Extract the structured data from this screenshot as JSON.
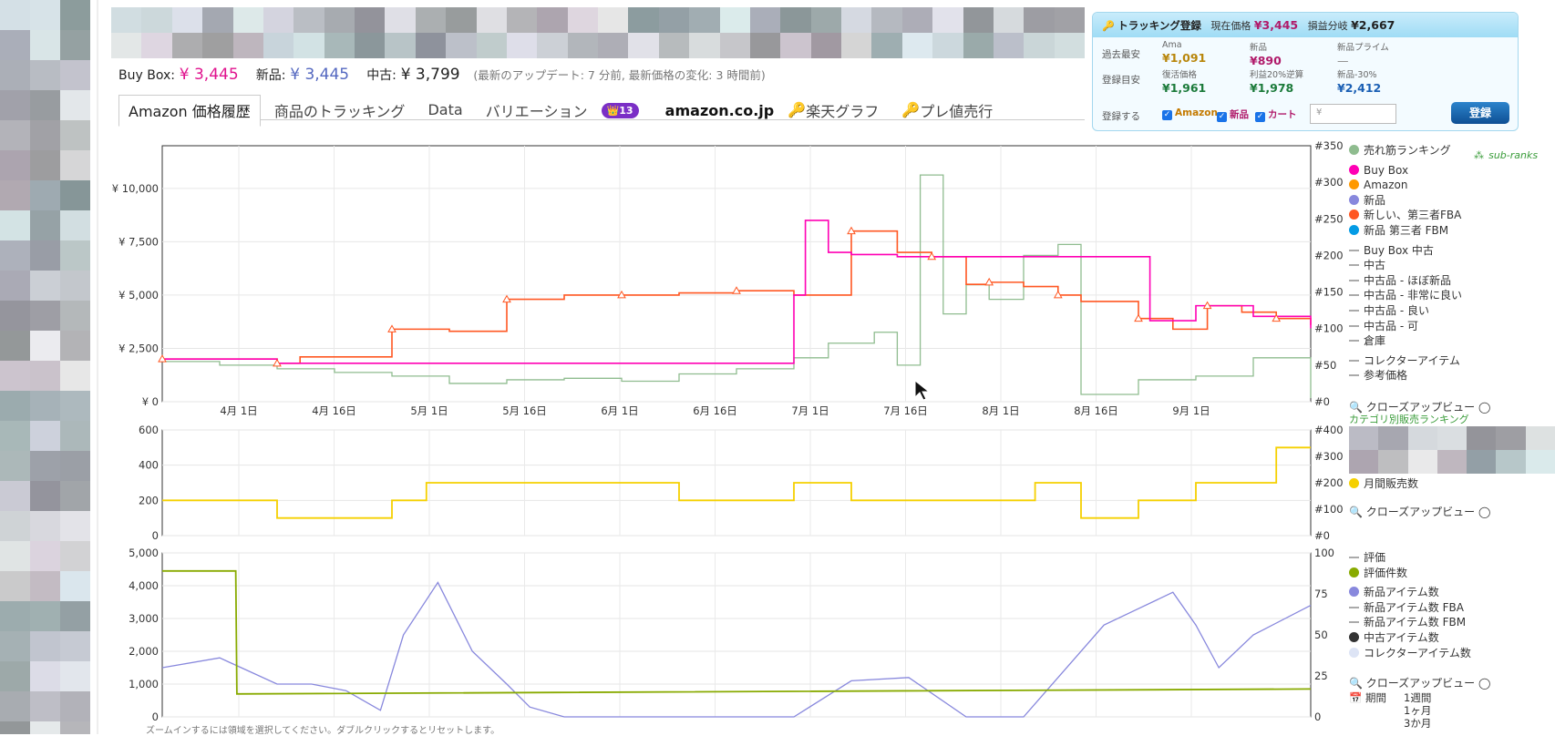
{
  "prices_bar": {
    "buybox_label": "Buy Box:",
    "buybox_value": "¥ 3,445",
    "new_label": "新品:",
    "new_value": "¥ 3,445",
    "used_label": "中古:",
    "used_value": "¥ 3,799",
    "update_note": "(最新のアップデート: 7 分前, 最新価格の変化: 3 時間前)"
  },
  "tabs": {
    "t1": "Amazon 価格履歴",
    "t2": "商品のトラッキング",
    "t3": "Data",
    "t4": "バリエーション",
    "badge": "👑13",
    "amazon_logo": "amazon.co.jp",
    "t5": "楽天グラフ",
    "t6": "プレ値売行"
  },
  "tracking": {
    "title": "トラッキング登録",
    "current_label": "現在価格",
    "current_value": "¥3,445",
    "breakeven_label": "損益分岐",
    "breakeven_value": "¥2,667",
    "row1_label": "過去最安",
    "row2_label": "登録目安",
    "row3_label": "登録する",
    "c_ama_label": "Ama",
    "c_ama_value": "¥1,091",
    "c_new_label": "新品",
    "c_new_value": "¥890",
    "c_prime_label": "新品プライム",
    "c_prime_value": "—",
    "c_revive_label": "復活価格",
    "c_revive_value": "¥1,961",
    "c_profit_label": "利益20%逆算",
    "c_profit_value": "¥1,978",
    "c_new30_label": "新品-30%",
    "c_new30_value": "¥2,412",
    "chk_amazon": "Amazon",
    "chk_new": "新品",
    "chk_cart": "カート",
    "input_placeholder": "¥",
    "register_button": "登録"
  },
  "legend1": {
    "items": [
      {
        "label": "売れ筋ランキング",
        "color": "#8fbc8f"
      },
      {
        "label": "Buy Box",
        "color": "#ff00b4"
      },
      {
        "label": "Amazon",
        "color": "#ff9900"
      },
      {
        "label": "新品",
        "color": "#8888dd"
      },
      {
        "label": "新しい、第三者FBA",
        "color": "#ff5722"
      },
      {
        "label": "新品 第三者 FBM",
        "color": "#039be5"
      },
      {
        "label": "Buy Box 中古",
        "color": "#aaaaaa"
      },
      {
        "label": "中古",
        "color": "#aaaaaa"
      },
      {
        "label": "中古品 - ほぼ新品",
        "color": "#aaaaaa"
      },
      {
        "label": "中古品 - 非常に良い",
        "color": "#aaaaaa"
      },
      {
        "label": "中古品 - 良い",
        "color": "#aaaaaa"
      },
      {
        "label": "中古品 - 可",
        "color": "#aaaaaa"
      },
      {
        "label": "倉庫",
        "color": "#aaaaaa"
      },
      {
        "label": "コレクターアイテム",
        "color": "#aaaaaa"
      },
      {
        "label": "参考価格",
        "color": "#aaaaaa"
      }
    ],
    "subranks": "sub-ranks",
    "zoom_label": "クローズアップビュー",
    "category_rank": "カテゴリ別販売ランキング"
  },
  "legend2": {
    "monthly_sales": "月間販売数",
    "zoom_label": "クローズアップビュー"
  },
  "legend3": {
    "items": [
      {
        "label": "評価",
        "color": "#aaaaaa",
        "shape": "dash"
      },
      {
        "label": "評価件数",
        "color": "#88aa00",
        "shape": "dot"
      },
      {
        "label": "新品アイテム数",
        "color": "#8888dd",
        "shape": "dot"
      },
      {
        "label": "新品アイテム数 FBA",
        "color": "#aaaaaa",
        "shape": "dash"
      },
      {
        "label": "新品アイテム数 FBM",
        "color": "#aaaaaa",
        "shape": "dash"
      },
      {
        "label": "中古アイテム数",
        "color": "#333333",
        "shape": "dot"
      },
      {
        "label": "コレクターアイテム数",
        "color": "#dde4f5",
        "shape": "dot"
      }
    ],
    "zoom_label": "クローズアップビュー",
    "period_label": "期間",
    "period_1w": "1週間",
    "period_1m": "1ヶ月",
    "period_3m": "3か月"
  },
  "footer_note": "ズームインするには領域を選択してください。ダブルクリックするとリセットします。",
  "chart_data": [
    {
      "type": "line",
      "x_ticks": [
        "4月 1日",
        "4月 16日",
        "5月 1日",
        "5月 16日",
        "6月 1日",
        "6月 16日",
        "7月 1日",
        "7月 16日",
        "8月 1日",
        "8月 16日",
        "9月 1日"
      ],
      "y_left_ticks": [
        "¥ 0",
        "¥ 2,500",
        "¥ 5,000",
        "¥ 7,500",
        "¥ 10,000"
      ],
      "y_right_ticks": [
        "#0",
        "#50",
        "#100",
        "#150",
        "#200",
        "#250",
        "#300",
        "#350"
      ],
      "ylim_left": [
        0,
        12000
      ],
      "ylim_right": [
        0,
        350
      ],
      "series": [
        {
          "name": "新しい、第三者FBA",
          "color": "#ff5722",
          "x": [
            0,
            0.06,
            0.1,
            0.12,
            0.2,
            0.25,
            0.3,
            0.35,
            0.4,
            0.45,
            0.5,
            0.55,
            0.6,
            0.64,
            0.67,
            0.7,
            0.72,
            0.75,
            0.78,
            0.8,
            0.85,
            0.88,
            0.91,
            0.94,
            0.97,
            1.0
          ],
          "y": [
            2000,
            2000,
            1800,
            2100,
            3400,
            3300,
            4800,
            5000,
            5000,
            5100,
            5200,
            5000,
            8000,
            7000,
            6800,
            5500,
            5600,
            5400,
            5000,
            4700,
            3900,
            3400,
            4500,
            4200,
            3900,
            3600
          ]
        },
        {
          "name": "Buy Box",
          "color": "#ff00b4",
          "x": [
            0,
            0.1,
            0.55,
            0.56,
            0.58,
            0.6,
            0.64,
            0.86,
            0.9,
            0.95,
            1.0
          ],
          "y": [
            2000,
            1800,
            5000,
            8500,
            7000,
            6900,
            6800,
            3800,
            4500,
            4000,
            3445
          ]
        },
        {
          "name": "売れ筋ランキング",
          "color": "#8fbc8f",
          "x": [
            0,
            0.05,
            0.1,
            0.15,
            0.2,
            0.25,
            0.3,
            0.35,
            0.4,
            0.45,
            0.5,
            0.55,
            0.58,
            0.62,
            0.64,
            0.66,
            0.68,
            0.7,
            0.72,
            0.75,
            0.78,
            0.8,
            0.85,
            0.9,
            0.95,
            1.0
          ],
          "y": [
            55,
            50,
            45,
            40,
            35,
            25,
            30,
            32,
            28,
            38,
            45,
            60,
            80,
            95,
            50,
            310,
            120,
            160,
            140,
            200,
            215,
            10,
            30,
            35,
            60,
            5
          ]
        }
      ]
    },
    {
      "type": "line",
      "y_left_ticks": [
        "0",
        "200",
        "400",
        "600"
      ],
      "y_right_ticks": [
        "#0",
        "#100",
        "#200",
        "#300",
        "#400"
      ],
      "ylim_left": [
        0,
        600
      ],
      "ylim_right": [
        0,
        400
      ],
      "series": [
        {
          "name": "月間販売数",
          "color": "#f5d000",
          "x": [
            0,
            0.1,
            0.2,
            0.23,
            0.3,
            0.4,
            0.45,
            0.5,
            0.55,
            0.6,
            0.7,
            0.76,
            0.8,
            0.85,
            0.9,
            0.95,
            0.97,
            1.0
          ],
          "y": [
            200,
            100,
            200,
            300,
            300,
            300,
            200,
            200,
            300,
            200,
            200,
            300,
            100,
            200,
            300,
            300,
            500,
            500
          ]
        }
      ]
    },
    {
      "type": "line",
      "y_left_ticks": [
        "0",
        "1,000",
        "2,000",
        "3,000",
        "4,000",
        "5,000"
      ],
      "y_right_ticks": [
        "0",
        "25",
        "50",
        "75",
        "100"
      ],
      "ylim_left": [
        0,
        5000
      ],
      "ylim_right": [
        0,
        100
      ],
      "series": [
        {
          "name": "評価件数",
          "color": "#88aa00",
          "x": [
            0,
            0.064,
            0.065,
            1.0
          ],
          "y": [
            4450,
            4450,
            700,
            850
          ]
        },
        {
          "name": "新品アイテム数",
          "color": "#8888dd",
          "x": [
            0,
            0.05,
            0.1,
            0.13,
            0.16,
            0.19,
            0.21,
            0.24,
            0.27,
            0.3,
            0.32,
            0.35,
            0.5,
            0.55,
            0.6,
            0.65,
            0.7,
            0.75,
            0.82,
            0.85,
            0.88,
            0.9,
            0.92,
            0.95,
            1.0
          ],
          "y": [
            1500,
            1800,
            1000,
            1000,
            800,
            200,
            2500,
            4100,
            2000,
            1000,
            300,
            0,
            0,
            0,
            1100,
            1200,
            0,
            0,
            2800,
            3300,
            3800,
            2800,
            1500,
            2500,
            3400
          ]
        }
      ]
    }
  ]
}
